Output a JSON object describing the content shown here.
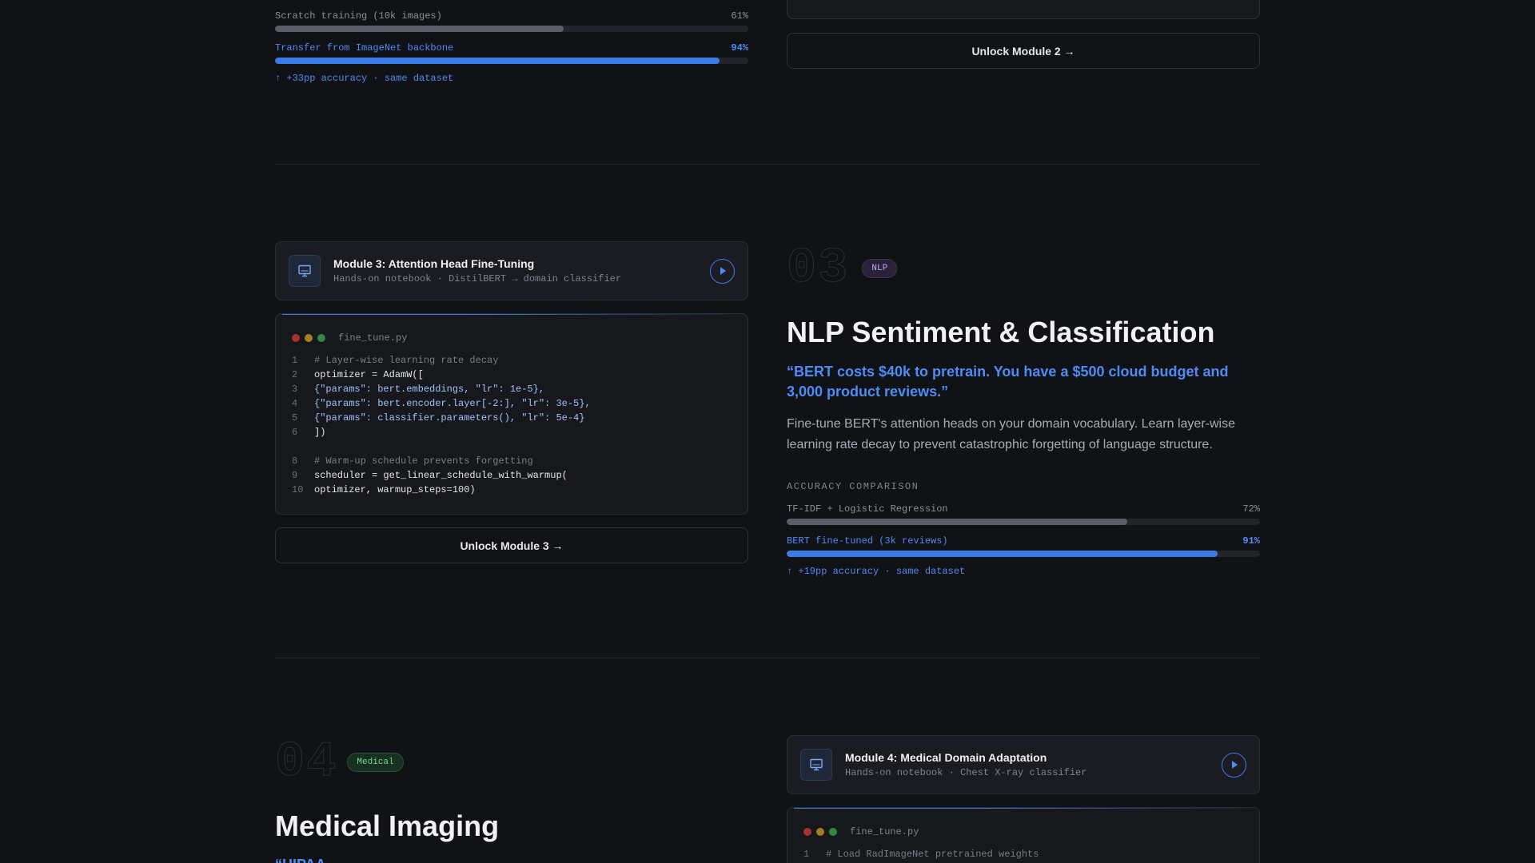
{
  "section2": {
    "comparison": {
      "rows": [
        {
          "label": "Scratch training (10k images)",
          "value_text": "61%",
          "value": 61,
          "highlight": false
        },
        {
          "label": "Transfer from ImageNet backbone",
          "value_text": "94%",
          "value": 94,
          "highlight": true
        }
      ],
      "note": "↑ +33pp accuracy · same dataset"
    },
    "unlock_label": "Unlock Module 2 →"
  },
  "section3": {
    "module": {
      "title": "Module 3: Attention Head Fine-Tuning",
      "subtitle": "Hands-on notebook · DistilBERT → domain classifier"
    },
    "code": {
      "filename": "fine_tune.py",
      "lines": [
        {
          "n": "1",
          "text": "# Layer-wise learning rate decay",
          "kind": "comment"
        },
        {
          "n": "2",
          "text": "optimizer = AdamW([",
          "kind": "text"
        },
        {
          "n": "3",
          "text": "{\"params\": bert.embeddings, \"lr\": 1e-5},",
          "kind": "blue"
        },
        {
          "n": "4",
          "text": "{\"params\": bert.encoder.layer[-2:], \"lr\": 3e-5},",
          "kind": "blue"
        },
        {
          "n": "5",
          "text": "{\"params\": classifier.parameters(), \"lr\": 5e-4}",
          "kind": "blue"
        },
        {
          "n": "6",
          "text": "])",
          "kind": "text"
        },
        {
          "n": "",
          "text": "",
          "kind": "text"
        },
        {
          "n": "8",
          "text": "# Warm-up schedule prevents forgetting",
          "kind": "comment"
        },
        {
          "n": "9",
          "text": "scheduler = get_linear_schedule_with_warmup(",
          "kind": "text"
        },
        {
          "n": "10",
          "text": "optimizer, warmup_steps=100)",
          "kind": "text"
        }
      ]
    },
    "unlock_label": "Unlock Module 3 →",
    "number": "03",
    "tag": "NLP",
    "title": "NLP Sentiment & Classification",
    "quote": "“BERT costs $40k to pretrain. You have a $500 cloud budget and 3,000 product reviews.”",
    "description": "Fine-tune BERT's attention heads on your domain vocabulary. Learn layer-wise learning rate decay to prevent catastrophic forgetting of language structure.",
    "comparison": {
      "heading": "ACCURACY COMPARISON",
      "rows": [
        {
          "label": "TF-IDF + Logistic Regression",
          "value_text": "72%",
          "value": 72,
          "highlight": false
        },
        {
          "label": "BERT fine-tuned (3k reviews)",
          "value_text": "91%",
          "value": 91,
          "highlight": true
        }
      ],
      "note": "↑ +19pp accuracy · same dataset"
    }
  },
  "section4": {
    "number": "04",
    "tag": "Medical",
    "title": "Medical Imaging",
    "quote_partial": "“HIPAA ... ... ... ... ... ... ... ... ... ... ... ... ...",
    "module": {
      "title": "Module 4: Medical Domain Adaptation",
      "subtitle": "Hands-on notebook · Chest X-ray classifier"
    },
    "code": {
      "filename": "fine_tune.py",
      "lines": [
        {
          "n": "1",
          "text": "# Load RadImageNet pretrained weights",
          "kind": "comment"
        }
      ]
    }
  },
  "colors": {
    "accent": "#3b7be8",
    "background": "#111216",
    "nlp_tag": "#c6a5ff",
    "medical_tag": "#6fdb8f"
  },
  "icons": [
    "monitor-icon",
    "play-icon"
  ]
}
